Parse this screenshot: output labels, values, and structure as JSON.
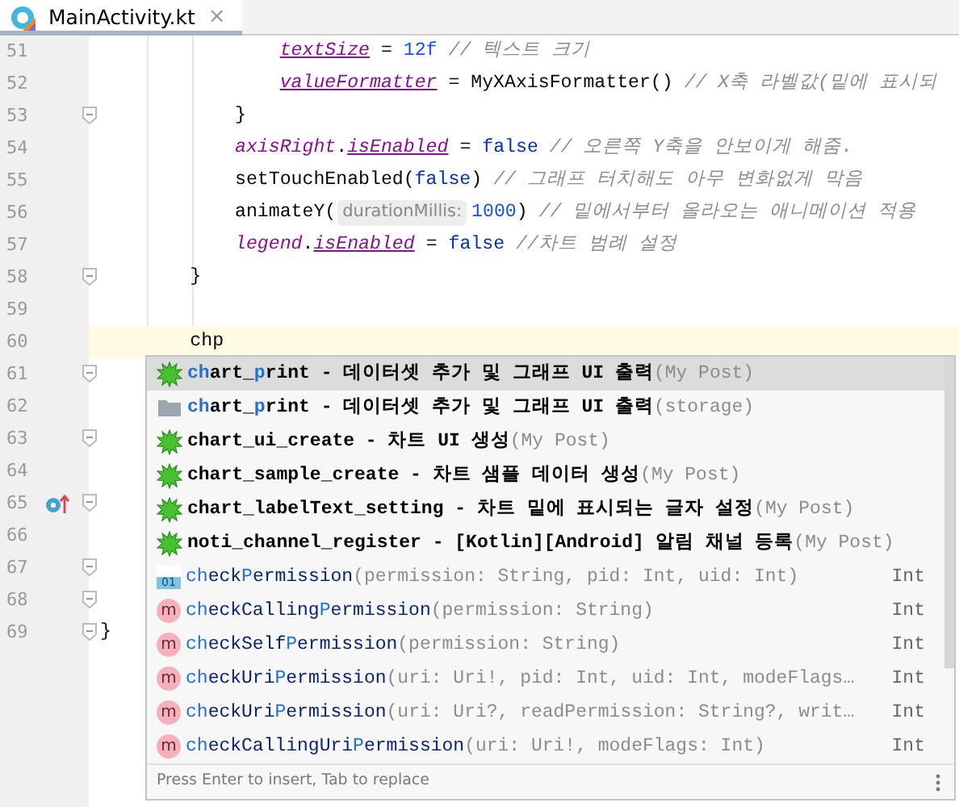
{
  "tab": {
    "title": "MainActivity.kt",
    "close": "×",
    "selected": true
  },
  "lines": [
    {
      "number": "51",
      "fold": false,
      "override_marker": false,
      "current": false,
      "tokens": [
        {
          "kind": "property",
          "text": "                textSize"
        },
        {
          "kind": "plain",
          "text": " = "
        },
        {
          "kind": "number",
          "text": "12f"
        },
        {
          "kind": "comment",
          "text": " // 텍스트 크기"
        }
      ]
    },
    {
      "number": "52",
      "fold": false,
      "override_marker": false,
      "current": false,
      "tokens": [
        {
          "kind": "property",
          "text": "                valueFormatter"
        },
        {
          "kind": "plain",
          "text": " = MyXAxisFormatter() "
        },
        {
          "kind": "comment",
          "text": "// X축 라벨값(밑에 표시되"
        }
      ]
    },
    {
      "number": "53",
      "fold": true,
      "override_marker": false,
      "current": false,
      "tokens": [
        {
          "kind": "plain",
          "text": "            }"
        }
      ]
    },
    {
      "number": "54",
      "fold": false,
      "override_marker": false,
      "current": false,
      "tokens": [
        {
          "kind": "synthetic",
          "text": "            axisRight"
        },
        {
          "kind": "plain",
          "text": "."
        },
        {
          "kind": "property",
          "text": "isEnabled"
        },
        {
          "kind": "plain",
          "text": " = "
        },
        {
          "kind": "keyword",
          "text": "false"
        },
        {
          "kind": "comment",
          "text": " // 오른쪽 Y축을 안보이게 해줌."
        }
      ]
    },
    {
      "number": "55",
      "fold": false,
      "override_marker": false,
      "current": false,
      "tokens": [
        {
          "kind": "plain",
          "text": "            setTouchEnabled("
        },
        {
          "kind": "keyword",
          "text": "false"
        },
        {
          "kind": "plain",
          "text": ")"
        },
        {
          "kind": "comment",
          "text": " // 그래프 터치해도 아무 변화없게 막음"
        }
      ]
    },
    {
      "number": "56",
      "fold": false,
      "override_marker": false,
      "current": false,
      "tokens": [
        {
          "kind": "plain",
          "text": "            animateY("
        },
        {
          "kind": "hint",
          "text": "durationMillis:"
        },
        {
          "kind": "number",
          "text": "1000"
        },
        {
          "kind": "plain",
          "text": ")"
        },
        {
          "kind": "comment",
          "text": " // 밑에서부터 올라오는 애니메이션 적용"
        }
      ]
    },
    {
      "number": "57",
      "fold": false,
      "override_marker": false,
      "current": false,
      "tokens": [
        {
          "kind": "synthetic",
          "text": "            legend"
        },
        {
          "kind": "plain",
          "text": "."
        },
        {
          "kind": "property",
          "text": "isEnabled"
        },
        {
          "kind": "plain",
          "text": " = "
        },
        {
          "kind": "keyword",
          "text": "false"
        },
        {
          "kind": "comment",
          "text": " //차트 범례 설정"
        }
      ]
    },
    {
      "number": "58",
      "fold": true,
      "override_marker": false,
      "current": false,
      "tokens": [
        {
          "kind": "plain",
          "text": "        }"
        }
      ]
    },
    {
      "number": "59",
      "fold": false,
      "override_marker": false,
      "current": false
    },
    {
      "number": "60",
      "fold": false,
      "override_marker": false,
      "current": true,
      "tokens": [
        {
          "kind": "plain",
          "text": "        chp"
        }
      ]
    },
    {
      "number": "61",
      "fold": true,
      "override_marker": false,
      "current": false
    },
    {
      "number": "62",
      "fold": false,
      "override_marker": false,
      "current": false
    },
    {
      "number": "63",
      "fold": true,
      "override_marker": false,
      "current": false
    },
    {
      "number": "64",
      "fold": false,
      "override_marker": false,
      "current": false
    },
    {
      "number": "65",
      "fold": true,
      "override_marker": true,
      "current": false
    },
    {
      "number": "66",
      "fold": false,
      "override_marker": false,
      "current": false
    },
    {
      "number": "67",
      "fold": true,
      "override_marker": false,
      "current": false
    },
    {
      "number": "68",
      "fold": true,
      "override_marker": false,
      "current": false
    },
    {
      "number": "69",
      "fold": true,
      "override_marker": false,
      "current": false,
      "tokens": [
        {
          "kind": "plain",
          "text": "}"
        }
      ]
    }
  ],
  "completion": {
    "items": [
      {
        "kind": "template",
        "selected": true,
        "name": [
          {
            "text": "ch",
            "match": true
          },
          {
            "text": "art_",
            "match": false
          },
          {
            "text": "p",
            "match": true
          },
          {
            "text": "rint",
            "match": false
          }
        ],
        "description": " - 데이터셋 추가 및 그래프 UI 출력",
        "source": "(My Post)"
      },
      {
        "kind": "folder",
        "selected": false,
        "name": [
          {
            "text": "ch",
            "match": true
          },
          {
            "text": "art_",
            "match": false
          },
          {
            "text": "p",
            "match": true
          },
          {
            "text": "rint",
            "match": false
          }
        ],
        "description": " - 데이터셋 추가 및 그래프 UI 출력",
        "source": "(storage)"
      },
      {
        "kind": "template",
        "selected": false,
        "name": [
          {
            "text": "chart_ui_create",
            "match": false
          }
        ],
        "description": " - 차트 UI 생성",
        "source": "(My Post)"
      },
      {
        "kind": "template",
        "selected": false,
        "name": [
          {
            "text": "chart_sample_create",
            "match": false
          }
        ],
        "description": " - 차트 샘플 데이터 생성",
        "source": "(My Post)"
      },
      {
        "kind": "template",
        "selected": false,
        "name": [
          {
            "text": "chart_labelText_setting",
            "match": false
          }
        ],
        "description": " - 차트 밑에 표시되는 글자 설정",
        "source": "(My Post)"
      },
      {
        "kind": "template",
        "selected": false,
        "name": [
          {
            "text": "noti_channel_register",
            "match": false
          }
        ],
        "description": " - [Kotlin][Android] 알림 채널 등록",
        "source": "(My Post)"
      },
      {
        "kind": "field",
        "badge": "01",
        "selected": false,
        "name": [
          {
            "text": "ch",
            "match": true
          },
          {
            "text": "eck",
            "match": false
          },
          {
            "text": "P",
            "match": true
          },
          {
            "text": "ermission",
            "match": false
          }
        ],
        "params": "(permission: String, pid: Int, uid: Int)",
        "type": "Int"
      },
      {
        "kind": "method",
        "badge": "m",
        "selected": false,
        "name": [
          {
            "text": "ch",
            "match": true
          },
          {
            "text": "eckCalling",
            "match": false
          },
          {
            "text": "P",
            "match": true
          },
          {
            "text": "ermission",
            "match": false
          }
        ],
        "params": "(permission: String)",
        "type": "Int"
      },
      {
        "kind": "method",
        "badge": "m",
        "selected": false,
        "name": [
          {
            "text": "ch",
            "match": true
          },
          {
            "text": "eckSelf",
            "match": false
          },
          {
            "text": "P",
            "match": true
          },
          {
            "text": "ermission",
            "match": false
          }
        ],
        "params": "(permission: String)",
        "type": "Int"
      },
      {
        "kind": "method",
        "badge": "m",
        "selected": false,
        "name": [
          {
            "text": "ch",
            "match": true
          },
          {
            "text": "eckUri",
            "match": false
          },
          {
            "text": "P",
            "match": true
          },
          {
            "text": "ermission",
            "match": false
          }
        ],
        "params": "(uri: Uri!, pid: Int, uid: Int, modeFlags…",
        "type": "Int"
      },
      {
        "kind": "method",
        "badge": "m",
        "selected": false,
        "name": [
          {
            "text": "ch",
            "match": true
          },
          {
            "text": "eckUri",
            "match": false
          },
          {
            "text": "P",
            "match": true
          },
          {
            "text": "ermission",
            "match": false
          }
        ],
        "params": "(uri: Uri?, readPermission: String?, writ…",
        "type": "Int"
      },
      {
        "kind": "method",
        "badge": "m",
        "selected": false,
        "name": [
          {
            "text": "ch",
            "match": true
          },
          {
            "text": "eckCallingUri",
            "match": false
          },
          {
            "text": "P",
            "match": true
          },
          {
            "text": "ermission",
            "match": false
          }
        ],
        "params": "(uri: Uri!, modeFlags: Int)",
        "type": "Int"
      }
    ],
    "footer": "Press Enter to insert, Tab to replace"
  }
}
